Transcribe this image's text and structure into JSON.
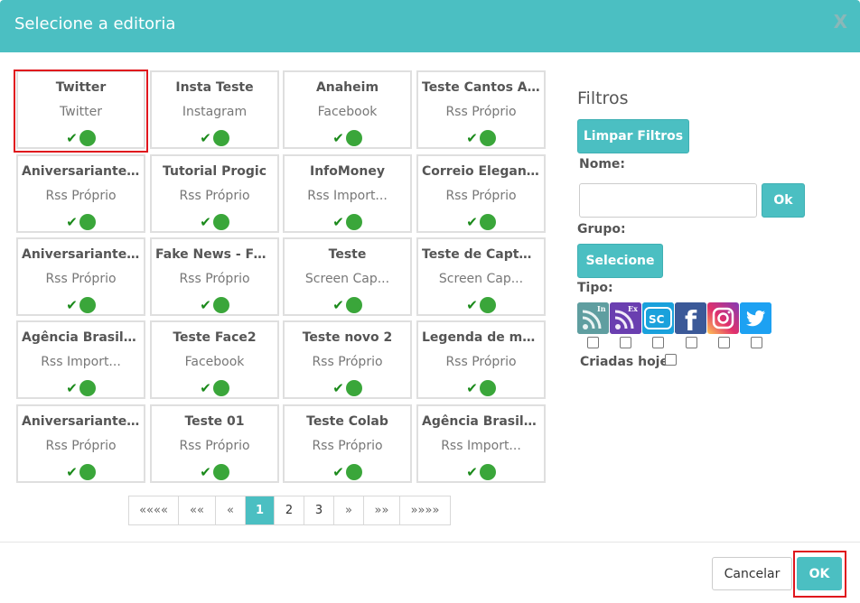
{
  "dialog": {
    "title": "Selecione a editoria",
    "close_label": "X"
  },
  "cards": [
    {
      "name": "Twitter",
      "type": "Twitter"
    },
    {
      "name": "Insta Teste",
      "type": "Instagram"
    },
    {
      "name": "Anaheim",
      "type": "Facebook"
    },
    {
      "name": "Teste Cantos Ar...",
      "type": "Rss Próprio"
    },
    {
      "name": "Aniversariantes...",
      "type": "Rss Próprio"
    },
    {
      "name": "Tutorial Progic",
      "type": "Rss Próprio"
    },
    {
      "name": "InfoMoney",
      "type": "Rss Import..."
    },
    {
      "name": "Correio Elegant...",
      "type": "Rss Próprio"
    },
    {
      "name": "Aniversariantes...",
      "type": "Rss Próprio"
    },
    {
      "name": "Fake News - Fe...",
      "type": "Rss Próprio"
    },
    {
      "name": "Teste",
      "type": "Screen Cap..."
    },
    {
      "name": "Teste de Captur...",
      "type": "Screen Cap..."
    },
    {
      "name": "Agência Brasil - ...",
      "type": "Rss Import..."
    },
    {
      "name": "Teste Face2",
      "type": "Facebook"
    },
    {
      "name": "Teste novo 2",
      "type": "Rss Próprio"
    },
    {
      "name": "Legenda de mol...",
      "type": "Rss Próprio"
    },
    {
      "name": "Aniversariantes...",
      "type": "Rss Próprio"
    },
    {
      "name": "Teste 01",
      "type": "Rss Próprio"
    },
    {
      "name": "Teste Colab",
      "type": "Rss Próprio"
    },
    {
      "name": "Agência Brasil - ...",
      "type": "Rss Import..."
    }
  ],
  "card_status": {
    "check": "✔",
    "status_color": "#3aa63a"
  },
  "pagination": {
    "first": "««««",
    "prev_many": "««",
    "prev": "«",
    "pages": [
      "1",
      "2",
      "3"
    ],
    "active_page": "1",
    "next": "»",
    "next_many": "»»",
    "last": "»»»»"
  },
  "filters": {
    "title": "Filtros",
    "clear_button": "Limpar Filtros",
    "name_label": "Nome:",
    "name_value": "",
    "name_ok_button": "Ok",
    "group_label": "Grupo:",
    "group_button": "Selecione",
    "type_label": "Tipo:",
    "types": [
      {
        "icon": "rss-import-icon",
        "badge": "In",
        "color": "#5f9ea0"
      },
      {
        "icon": "rss-own-icon",
        "badge": "Ex",
        "color": "#6a3fb0"
      },
      {
        "icon": "screen-capture-icon",
        "badge": "SC",
        "color": "#1aa1dc"
      },
      {
        "icon": "facebook-icon",
        "badge": "f",
        "color": "#3b5998"
      },
      {
        "icon": "instagram-icon",
        "badge": "",
        "color": "#c13584"
      },
      {
        "icon": "twitter-icon",
        "badge": "",
        "color": "#1da1f2"
      }
    ],
    "created_today_label": "Criadas hoje"
  },
  "footer": {
    "cancel_button": "Cancelar",
    "ok_button": "OK"
  },
  "colors": {
    "accent": "#4bbfc2",
    "highlight_border": "#e0161d"
  }
}
